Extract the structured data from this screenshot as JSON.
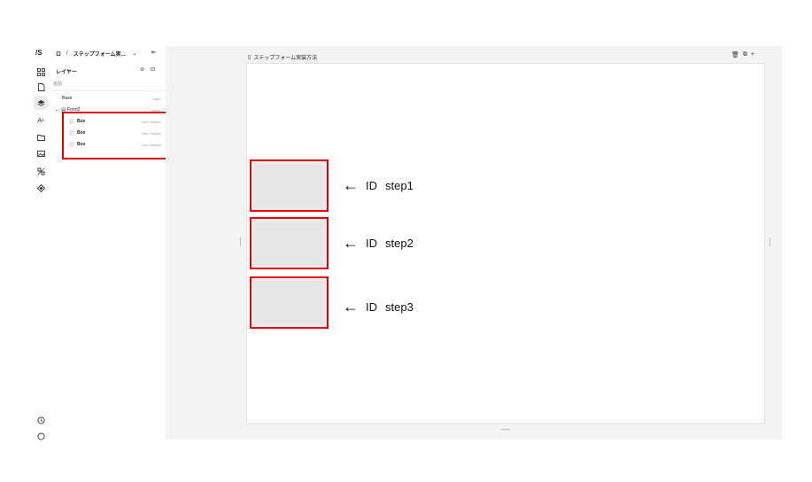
{
  "header": {
    "breadcrumb_root": "ロ",
    "breadcrumb_sep": "/",
    "project_name": "ステップフォーム実..."
  },
  "rail": {
    "logo": "/S",
    "icons": [
      "grid-icon",
      "page-icon",
      "layers-icon",
      "typography-icon",
      "folder-icon",
      "image-icon",
      "component-icon",
      "plugin-icon",
      "history-icon",
      "help-icon"
    ]
  },
  "layers": {
    "title": "レイヤー",
    "search_placeholder": "名前",
    "items": [
      {
        "label": "Base",
        "tag": "<div>"
      },
      {
        "label": "Form2",
        "tag": "<form>"
      },
      {
        "label": "Box",
        "tag": "<div> #step1"
      },
      {
        "label": "Box",
        "tag": "<div> #step2"
      },
      {
        "label": "Box",
        "tag": "<div> #step3"
      }
    ]
  },
  "document": {
    "name": "ステップフォーム実装方法"
  },
  "steps": [
    {
      "id_prefix": "ID",
      "id": "step1"
    },
    {
      "id_prefix": "ID",
      "id": "step2"
    },
    {
      "id_prefix": "ID",
      "id": "step3"
    }
  ],
  "colors": {
    "highlight": "#e00000",
    "canvas_bg": "#f3f3f3"
  }
}
